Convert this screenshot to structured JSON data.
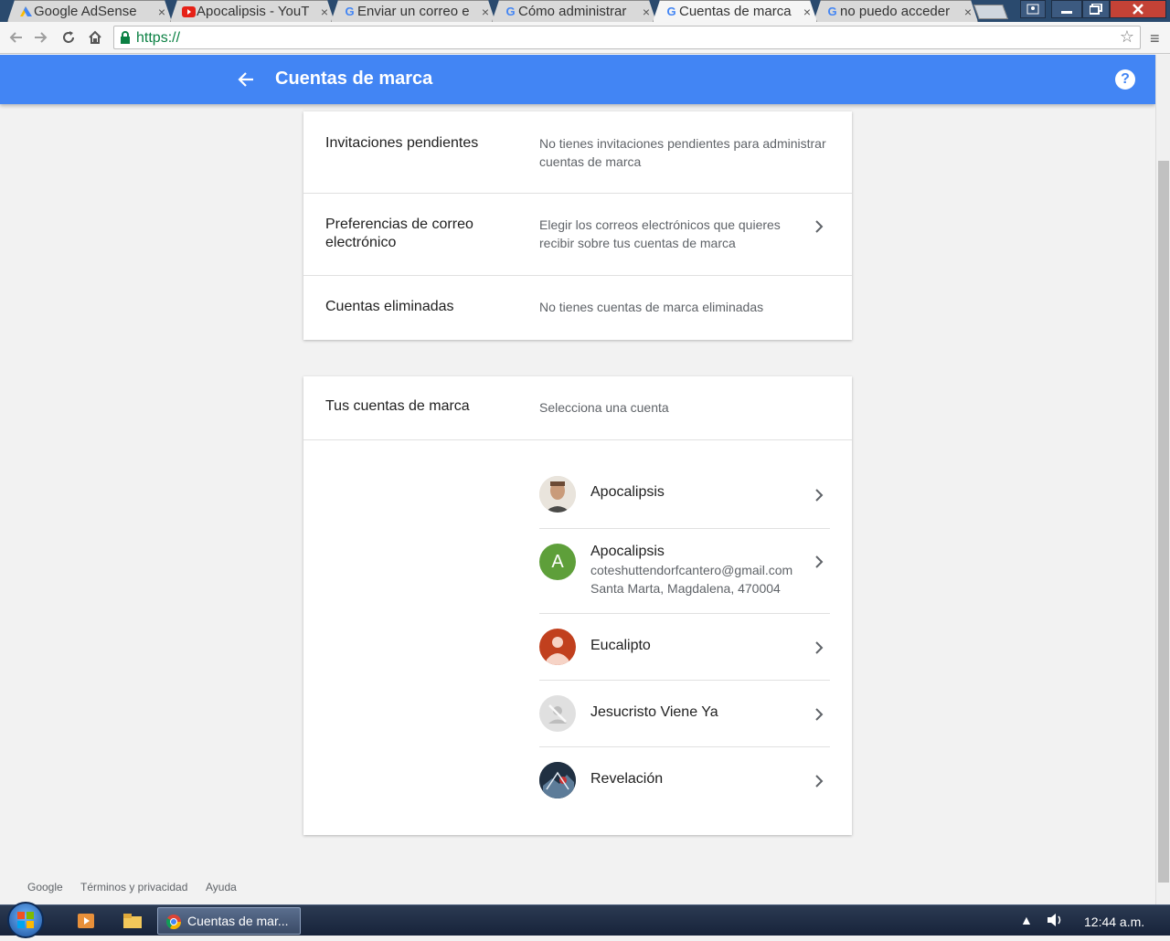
{
  "browser": {
    "tabs": [
      {
        "label": "Google AdSense",
        "icon": "adsense-icon",
        "active": false
      },
      {
        "label": "Apocalipsis - YouT",
        "icon": "youtube-icon",
        "active": false
      },
      {
        "label": "Enviar un correo e",
        "icon": "google-icon",
        "active": false
      },
      {
        "label": "Cómo administrar",
        "icon": "google-icon",
        "active": false
      },
      {
        "label": "Cuentas de marca",
        "icon": "google-icon",
        "active": true
      },
      {
        "label": "no puedo acceder",
        "icon": "google-icon",
        "active": false
      }
    ],
    "url": "https://",
    "close_glyph": "×"
  },
  "appbar": {
    "title": "Cuentas de marca",
    "help_glyph": "?"
  },
  "settings_card": {
    "rows": [
      {
        "label": "Invitaciones pendientes",
        "description": "No tienes invitaciones pendientes para administrar cuentas de marca"
      },
      {
        "label": "Preferencias de correo electrónico",
        "description": "Elegir los correos electrónicos que quieres recibir sobre tus cuentas de marca"
      },
      {
        "label": "Cuentas eliminadas",
        "description": "No tienes cuentas de marca eliminadas"
      }
    ]
  },
  "accounts_card": {
    "label": "Tus cuentas de marca",
    "description": "Selecciona una cuenta",
    "accounts": [
      {
        "name": "Apocalipsis",
        "avatar": "photo-avatar"
      },
      {
        "name": "Apocalipsis",
        "email": "coteshuttendorfcantero@gmail.com",
        "address": "Santa Marta, Magdalena, 470004",
        "avatar_letter": "A",
        "avatar_color": "#5e9f3a"
      },
      {
        "name": "Eucalipto",
        "avatar": "person-avatar",
        "avatar_color": "#c1401e"
      },
      {
        "name": "Jesucristo Viene Ya",
        "avatar": "no-photo-avatar"
      },
      {
        "name": "Revelación",
        "avatar": "image-avatar"
      }
    ]
  },
  "footer": {
    "links": [
      "Google",
      "Términos y privacidad",
      "Ayuda"
    ]
  },
  "taskbar": {
    "task_label": "Cuentas de mar...",
    "clock": "12:44 a.m."
  },
  "colors": {
    "appbar": "#4285f4",
    "background": "#f2f2f2"
  }
}
